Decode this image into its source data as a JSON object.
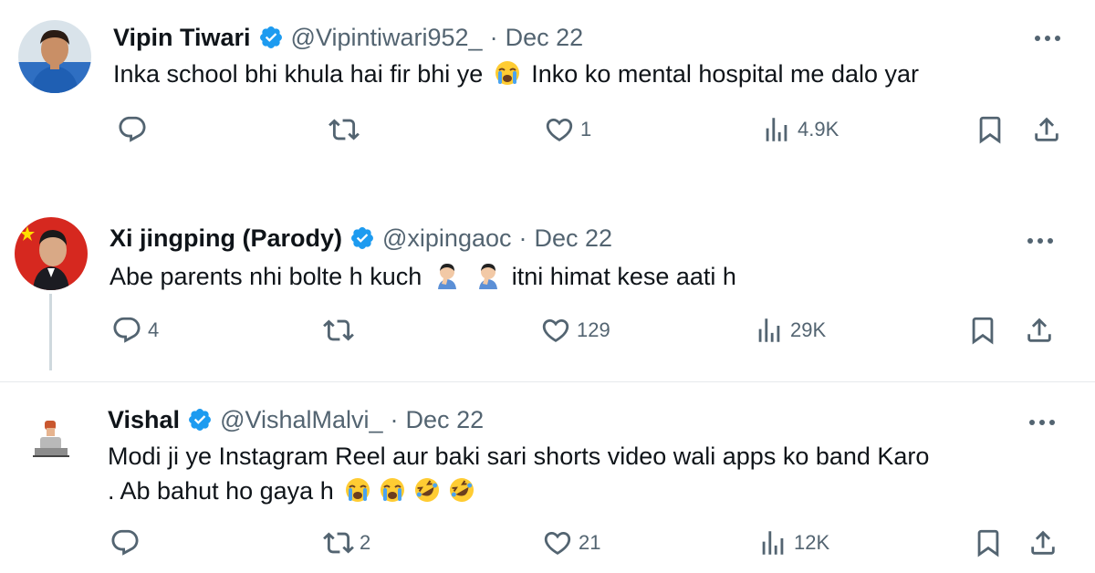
{
  "tweets": [
    {
      "name": "Vipin Tiwari",
      "handle": "@Vipintiwari952_",
      "separator": "·",
      "date": "Dec 22",
      "text_before": "Inka school bhi khula hai fir bhi ye",
      "text_after": "Inko ko mental hospital me dalo yar",
      "emojis": [
        "loudly-crying-face"
      ],
      "replies": "",
      "retweets": "",
      "likes": "1",
      "views": "4.9K"
    },
    {
      "name": "Xi jingping (Parody)",
      "handle": "@xipingaoc",
      "separator": "·",
      "date": "Dec 22",
      "text_before": "Abe parents nhi bolte h kuch",
      "text_after": "itni himat kese aati h",
      "emojis": [
        "facepalm",
        "facepalm"
      ],
      "replies": "4",
      "retweets": "",
      "likes": "129",
      "views": "29K"
    },
    {
      "name": "Vishal",
      "handle": "@VishalMalvi_",
      "separator": "·",
      "date": "Dec 22",
      "text_line1": "Modi ji ye Instagram Reel aur baki sari shorts video wali apps ko band Karo",
      "text_line2": ". Ab bahut ho gaya h",
      "emojis": [
        "loudly-crying-face",
        "loudly-crying-face",
        "rolling-on-floor-laughing",
        "rolling-on-floor-laughing"
      ],
      "replies": "",
      "retweets": "2",
      "likes": "21",
      "views": "12K"
    }
  ],
  "colors": {
    "text": "#0f1419",
    "muted": "#536471",
    "verified": "#1d9bf0",
    "divider": "#e6e9ec",
    "thread_line": "#cfd9de"
  },
  "icons": [
    "reply-icon",
    "retweet-icon",
    "like-icon",
    "views-icon",
    "bookmark-icon",
    "share-icon",
    "more-icon",
    "verified-badge-icon"
  ]
}
